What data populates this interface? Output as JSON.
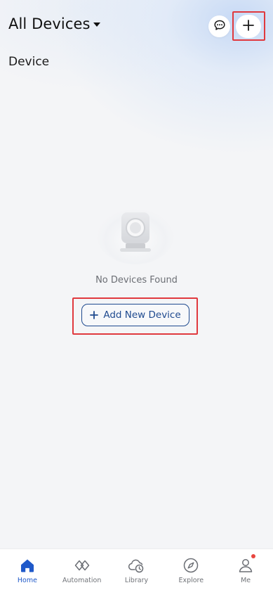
{
  "header": {
    "home_selector": "All Devices",
    "message_icon": "chat-bubble-icon",
    "add_icon": "plus-icon"
  },
  "section": {
    "title": "Device"
  },
  "empty_state": {
    "illustration": "device-placeholder-icon",
    "message": "No Devices Found",
    "add_button_label": "Add New Device"
  },
  "tabbar": {
    "items": [
      {
        "label": "Home",
        "icon": "home-icon",
        "active": true
      },
      {
        "label": "Automation",
        "icon": "automation-icon",
        "active": false
      },
      {
        "label": "Library",
        "icon": "cloud-clock-icon",
        "active": false
      },
      {
        "label": "Explore",
        "icon": "compass-icon",
        "active": false
      },
      {
        "label": "Me",
        "icon": "person-icon",
        "active": false,
        "badge": true
      }
    ]
  },
  "colors": {
    "accent": "#1f59c9",
    "button_border": "#1f4a8f",
    "highlight_box": "#e0393e",
    "badge": "#e8463f",
    "background": "#f4f5f7"
  }
}
